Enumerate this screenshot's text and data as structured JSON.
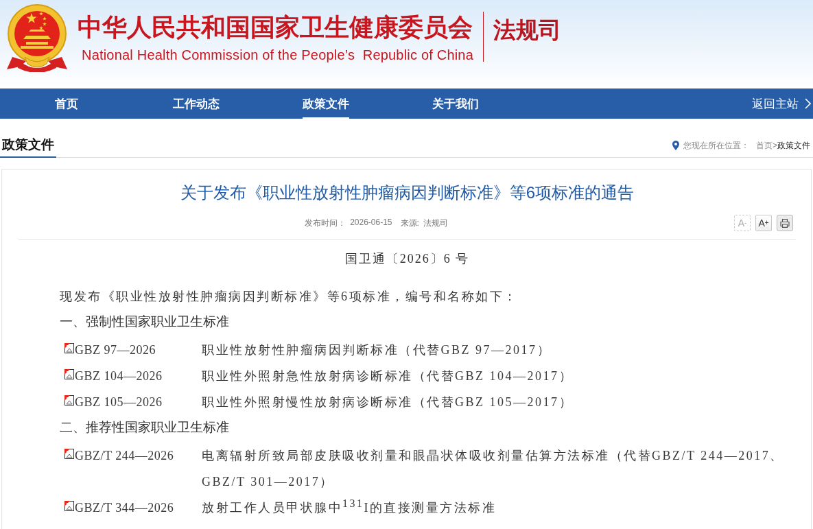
{
  "header": {
    "title": "中华人民共和国国家卫生健康委员会",
    "subtitle": "National Health Commission of the People’s  Republic of China",
    "department": "法规司"
  },
  "nav": {
    "items": [
      {
        "label": "首页",
        "selected": false
      },
      {
        "label": "工作动态",
        "selected": false
      },
      {
        "label": "政策文件",
        "selected": true
      },
      {
        "label": "关于我们",
        "selected": false
      }
    ],
    "back_link": "返回主站"
  },
  "section": {
    "title": "政策文件",
    "breadcrumb": {
      "prefix": "您现在所在位置：",
      "separator": ">",
      "items": [
        {
          "label": "首页",
          "current": false
        },
        {
          "label": "政策文件",
          "current": true
        }
      ]
    }
  },
  "article": {
    "title": "关于发布《职业性放射性肿瘤病因判断标准》等6项标准的通告",
    "meta": [
      {
        "label": "发布时间：",
        "value": "2026-06-15"
      },
      {
        "label": "来源:",
        "value": "法规司"
      }
    ],
    "tools": [
      {
        "kind": "font_smaller",
        "label": "A$^{-}$",
        "disabled": true
      },
      {
        "kind": "font_larger",
        "label": "A$^{+}$",
        "disabled": false
      },
      {
        "kind": "print",
        "disabled": false
      }
    ],
    "doc_number": "国卫通〔2026〕6 号",
    "intro": "现发布《职业性放射性肿瘤病因判断标准》等6项标准，编号和名称如下：",
    "groups": [
      {
        "heading": "一、强制性国家职业卫生标准",
        "items": [
          {
            "code": "GBZ 97—2026",
            "name": "职业性放射性肿瘤病因判断标准（代替GBZ 97—2017）"
          },
          {
            "code": "GBZ 104—2026",
            "name": "职业性外照射急性放射病诊断标准（代替GBZ 104—2017）"
          },
          {
            "code": "GBZ 105—2026",
            "name": "职业性外照射慢性放射病诊断标准（代替GBZ 105—2017）"
          }
        ]
      },
      {
        "heading": "二、推荐性国家职业卫生标准",
        "items": [
          {
            "code": "GBZ/T 244—2026",
            "name": "电离辐射所致局部皮肤吸收剂量和眼晶状体吸收剂量估算方法标准（代替GBZ/T 244—2017、GBZ/T 301—2017）"
          },
          {
            "code": "GBZ/T 344—2026",
            "name": "放射工作人员甲状腺中$^{131}$I的直接测量方法标准"
          }
        ]
      }
    ]
  }
}
